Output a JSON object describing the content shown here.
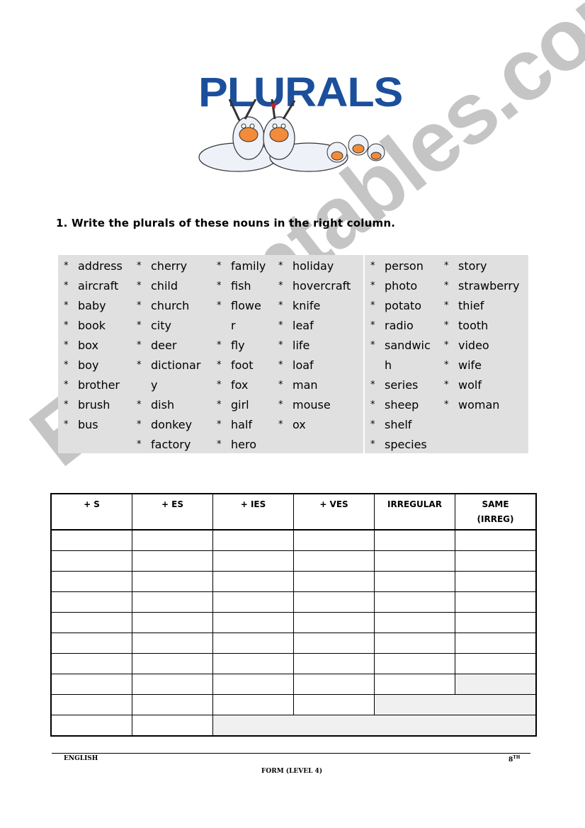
{
  "header": {
    "logo_title": "PLURALS",
    "logo_image": "cartoon-rabbits"
  },
  "instruction": "1. Write the plurals of these nouns in the right column.",
  "word_box": {
    "bullet": "*",
    "columns": [
      [
        {
          "text": "address",
          "bullet": true
        },
        {
          "text": "aircraft",
          "bullet": true
        },
        {
          "text": "baby",
          "bullet": true
        },
        {
          "text": "book",
          "bullet": true
        },
        {
          "text": "box",
          "bullet": true
        },
        {
          "text": "boy",
          "bullet": true
        },
        {
          "text": "brother",
          "bullet": true
        },
        {
          "text": "brush",
          "bullet": true
        },
        {
          "text": "bus",
          "bullet": true
        }
      ],
      [
        {
          "text": "cherry",
          "bullet": true
        },
        {
          "text": "child",
          "bullet": true
        },
        {
          "text": "church",
          "bullet": true
        },
        {
          "text": "city",
          "bullet": true
        },
        {
          "text": "deer",
          "bullet": true
        },
        {
          "text": "dictionar",
          "bullet": true
        },
        {
          "text": "y",
          "bullet": false
        },
        {
          "text": "dish",
          "bullet": true
        },
        {
          "text": "donkey",
          "bullet": true
        },
        {
          "text": "factory",
          "bullet": true
        }
      ],
      [
        {
          "text": "family",
          "bullet": true
        },
        {
          "text": "fish",
          "bullet": true
        },
        {
          "text": "flowe",
          "bullet": true
        },
        {
          "text": "r",
          "bullet": false
        },
        {
          "text": "fly",
          "bullet": true
        },
        {
          "text": "foot",
          "bullet": true
        },
        {
          "text": "fox",
          "bullet": true
        },
        {
          "text": "girl",
          "bullet": true
        },
        {
          "text": "half",
          "bullet": true
        },
        {
          "text": "hero",
          "bullet": true
        }
      ],
      [
        {
          "text": "holiday",
          "bullet": true
        },
        {
          "text": "hovercraft",
          "bullet": true
        },
        {
          "text": "knife",
          "bullet": true
        },
        {
          "text": "leaf",
          "bullet": true
        },
        {
          "text": "life",
          "bullet": true
        },
        {
          "text": "loaf",
          "bullet": true
        },
        {
          "text": "man",
          "bullet": true
        },
        {
          "text": "mouse",
          "bullet": true
        },
        {
          "text": "ox",
          "bullet": true
        }
      ],
      [
        {
          "text": "person",
          "bullet": true
        },
        {
          "text": "photo",
          "bullet": true
        },
        {
          "text": "potato",
          "bullet": true
        },
        {
          "text": "radio",
          "bullet": true
        },
        {
          "text": "sandwic",
          "bullet": true
        },
        {
          "text": "h",
          "bullet": false
        },
        {
          "text": "series",
          "bullet": true
        },
        {
          "text": "sheep",
          "bullet": true
        },
        {
          "text": "shelf",
          "bullet": true
        },
        {
          "text": "species",
          "bullet": true
        }
      ],
      [
        {
          "text": "story",
          "bullet": true
        },
        {
          "text": "strawberry",
          "bullet": true
        },
        {
          "text": "thief",
          "bullet": true
        },
        {
          "text": "tooth",
          "bullet": true
        },
        {
          "text": "video",
          "bullet": true
        },
        {
          "text": "wife",
          "bullet": true
        },
        {
          "text": "wolf",
          "bullet": true
        },
        {
          "text": "woman",
          "bullet": true
        }
      ]
    ]
  },
  "sort_table": {
    "headers": [
      "+ S",
      "+ ES",
      "+ IES",
      "+ VES",
      "IRREGULAR",
      "SAME (IRREG)"
    ],
    "answer_rows_per_column": [
      10,
      10,
      9,
      9,
      8,
      7
    ],
    "total_rows": 10
  },
  "footer": {
    "left": "ENGLISH",
    "right": "8",
    "right_sup": "TH",
    "center": "FORM (LEVEL 4)"
  },
  "watermark": "ESLprintables.com",
  "colors": {
    "title_blue": "#1b4f9c",
    "box_gray": "#e0e0e0",
    "shaded_cell": "#f0f0f0"
  }
}
